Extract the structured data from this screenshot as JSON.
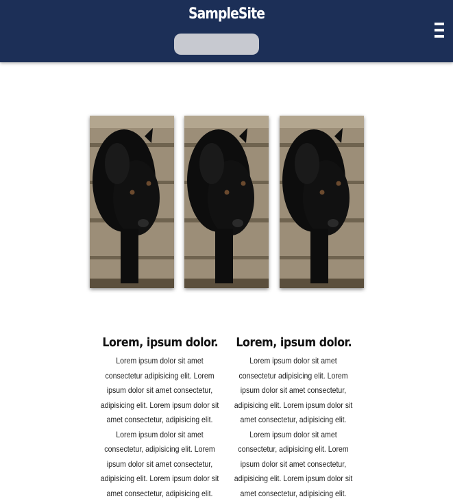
{
  "header": {
    "site_title": "SampleSite",
    "search_value": "",
    "menu_icon": "hamburger-menu-icon",
    "background_color": "#1c2f57"
  },
  "gallery": {
    "images": [
      {
        "subject": "black dog on wooden floor"
      },
      {
        "subject": "black dog on wooden floor"
      },
      {
        "subject": "black dog on wooden floor"
      }
    ]
  },
  "articles": [
    {
      "heading": "Lorem, ipsum dolor.",
      "body": "Lorem ipsum dolor sit amet consectetur adipisicing elit. Lorem ipsum dolor sit amet consectetur, adipisicing elit. Lorem ipsum dolor sit amet consectetur, adipisicing elit. Lorem ipsum dolor sit amet consectetur, adipisicing elit. Lorem ipsum dolor sit amet consectetur, adipisicing elit. Lorem ipsum dolor sit amet consectetur, adipisicing elit."
    },
    {
      "heading": "Lorem, ipsum dolor.",
      "body": "Lorem ipsum dolor sit amet consectetur adipisicing elit. Lorem ipsum dolor sit amet consectetur, adipisicing elit. Lorem ipsum dolor sit amet consectetur, adipisicing elit. Lorem ipsum dolor sit amet consectetur, adipisicing elit. Lorem ipsum dolor sit amet consectetur, adipisicing elit. Lorem ipsum dolor sit amet consectetur, adipisicing elit."
    }
  ]
}
